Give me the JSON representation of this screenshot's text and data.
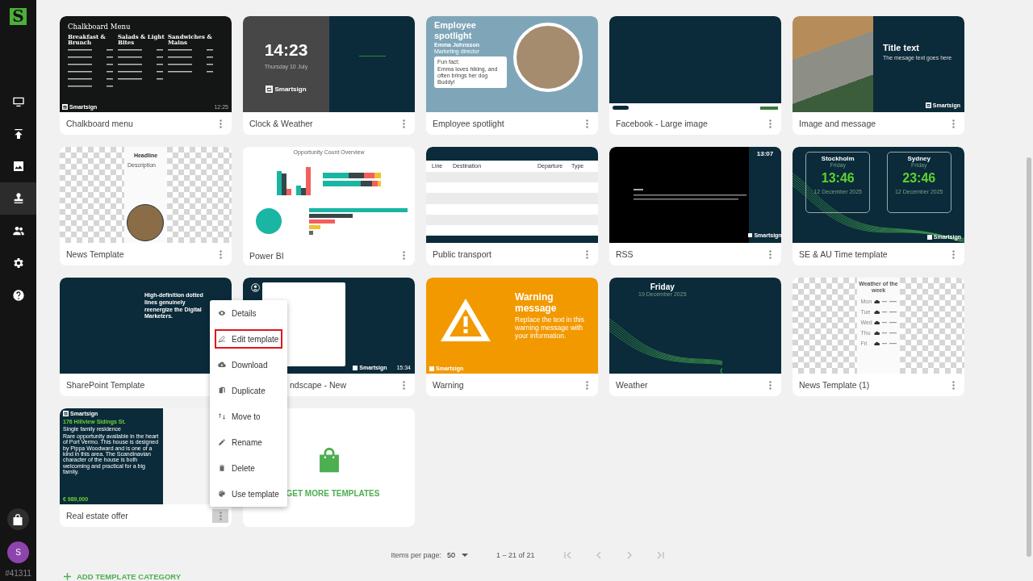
{
  "sidebar": {
    "logo": "S",
    "items": [
      {
        "kind": "monitor",
        "selected": false
      },
      {
        "kind": "upload",
        "selected": false
      },
      {
        "kind": "image",
        "selected": false
      },
      {
        "kind": "stamp",
        "selected": true
      },
      {
        "kind": "people",
        "selected": false
      },
      {
        "kind": "gear",
        "selected": false
      },
      {
        "kind": "help",
        "selected": false
      }
    ],
    "avatar": "S",
    "account": "#41311"
  },
  "templates": [
    {
      "name": "Chalkboard menu",
      "menu_open": false,
      "covered": false,
      "thumb": {
        "kind": "chalkboard",
        "title": "Chalkboard Menu",
        "headings": [
          "Breakfast & Brunch",
          "Salads & Light Bites",
          "Sandwiches & Mains"
        ],
        "brand": "Smartsign",
        "time": "12:25"
      }
    },
    {
      "name": "Clock & Weather",
      "menu_open": false,
      "covered": false,
      "thumb": {
        "kind": "clock",
        "time": "14:23",
        "date": "Thursday 10 July",
        "brand": "Smartsign"
      }
    },
    {
      "name": "Employee spotlight",
      "menu_open": false,
      "covered": false,
      "thumb": {
        "kind": "spotlight",
        "title": "Employee spotlight",
        "person": "Emma Johnsson",
        "role": "Marketing director",
        "fact_label": "Fun fact:",
        "fact": "Emma loves hiking, and often brings her dog Buddy!"
      }
    },
    {
      "name": "Facebook - Large image",
      "menu_open": false,
      "covered": false,
      "thumb": {
        "kind": "facebook"
      }
    },
    {
      "name": "Image and message",
      "menu_open": false,
      "covered": false,
      "thumb": {
        "kind": "image_message",
        "title": "Title text",
        "message": "The mesage text goes here",
        "brand": "Smartsign"
      }
    },
    {
      "name": "News Template",
      "menu_open": false,
      "covered": false,
      "thumb": {
        "kind": "news",
        "headline": "Headline",
        "description": "Description"
      }
    },
    {
      "name": "Power BI",
      "menu_open": false,
      "covered": false,
      "thumb": {
        "kind": "powerbi",
        "title": "Opportunity Count Overview"
      }
    },
    {
      "name": "Public transport",
      "menu_open": false,
      "covered": false,
      "thumb": {
        "kind": "transport",
        "columns": [
          "Line",
          "Destination",
          "Departure",
          "Type"
        ]
      }
    },
    {
      "name": "RSS",
      "menu_open": false,
      "covered": false,
      "thumb": {
        "kind": "rss",
        "time": "13:07",
        "brand": "Smartsign"
      }
    },
    {
      "name": "SE & AU Time template",
      "menu_open": false,
      "covered": false,
      "thumb": {
        "kind": "clocks",
        "clocks": [
          {
            "city": "Stockholm",
            "day": "Friday",
            "time": "13:46",
            "date": "12 December 2025"
          },
          {
            "city": "Sydney",
            "day": "Friday",
            "time": "23:46",
            "date": "12 December 2025"
          }
        ],
        "brand": "Smartsign"
      }
    },
    {
      "name": "SharePoint Template",
      "covered": false,
      "thumb": {
        "kind": "sharepoint",
        "text": "High-definition dotted lines genuinely reenergize the Digital Marketers."
      }
    },
    {
      "name": "ndscape - New",
      "menu_open": false,
      "covered": true,
      "thumb": {
        "kind": "landscape",
        "time": "15:34",
        "brand": "Smartsign"
      }
    },
    {
      "name": "Warning",
      "menu_open": false,
      "covered": false,
      "thumb": {
        "kind": "warning",
        "title": "Warning message",
        "text": "Replace the text in this warning message with your information.",
        "brand": "Smartsign"
      }
    },
    {
      "name": "Weather",
      "menu_open": false,
      "covered": false,
      "thumb": {
        "kind": "weather",
        "day": "Friday",
        "date": "19 December 2025"
      }
    },
    {
      "name": "News Template (1)",
      "menu_open": false,
      "covered": false,
      "thumb": {
        "kind": "week_weather",
        "title": "Weather of the week",
        "days": [
          "Mon",
          "Tue",
          "Wed",
          "Thu",
          "Fri"
        ]
      }
    },
    {
      "name": "Real estate offer",
      "menu_open": true,
      "covered": false,
      "thumb": {
        "kind": "real_estate",
        "brand": "Smartsign",
        "address": "176 Hillview Sidings St.",
        "type": "Single family residence",
        "description": "Rare opportunity available in the heart of Port Vermo. This house is designed by Pippa Woodward and is one of a kind in this area. The Scandinavian character of the house is both welcoming and practical for a big family.",
        "price": "€ 989,000"
      }
    }
  ],
  "get_more": {
    "label": "GET MORE TEMPLATES"
  },
  "context_menu": [
    {
      "kind": "eye",
      "label": "Details",
      "highlighted": false
    },
    {
      "kind": "edit",
      "label": "Edit template",
      "highlighted": true
    },
    {
      "kind": "download",
      "label": "Download",
      "highlighted": false
    },
    {
      "kind": "duplicate",
      "label": "Duplicate",
      "highlighted": false
    },
    {
      "kind": "move",
      "label": "Move to",
      "highlighted": false
    },
    {
      "kind": "rename",
      "label": "Rename",
      "highlighted": false
    },
    {
      "kind": "delete",
      "label": "Delete",
      "highlighted": false
    },
    {
      "kind": "palette",
      "label": "Use template",
      "highlighted": false
    }
  ],
  "pagination": {
    "items_label": "Items per page:",
    "per_page": "50",
    "range": "1 – 21 of 21",
    "buttons": [
      {
        "kind": "first"
      },
      {
        "kind": "prev"
      },
      {
        "kind": "next"
      },
      {
        "kind": "last"
      }
    ]
  },
  "add_category": "ADD TEMPLATE CATEGORY"
}
